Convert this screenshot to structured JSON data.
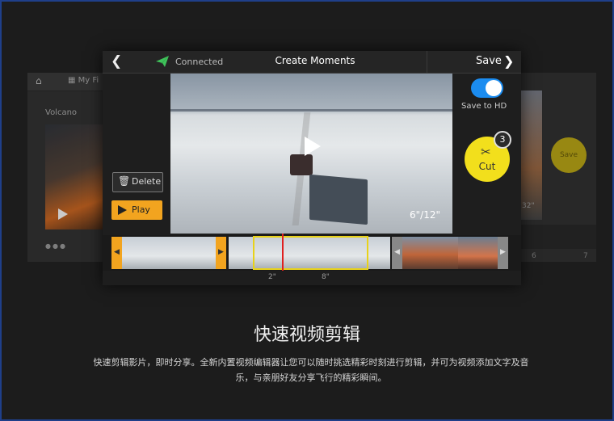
{
  "background_left": {
    "tab_label": "My Fi",
    "album_title": "Volcano"
  },
  "background_right": {
    "save_label": "Save",
    "duration_label": "32\"",
    "numbers": [
      "6",
      "7"
    ]
  },
  "toolbar": {
    "connection_status": "Connected",
    "title": "Create Moments",
    "save_label": "Save"
  },
  "video": {
    "time_display": "6\"/12\""
  },
  "controls": {
    "delete_label": "Delete",
    "play_label": "Play",
    "save_to_hd_label": "Save to HD",
    "save_to_hd_enabled": true,
    "cut_label": "Cut",
    "cut_count": "3"
  },
  "timeline": {
    "markers": [
      "2\"",
      "8\""
    ]
  },
  "caption": {
    "heading": "快速视频剪辑",
    "description": "快速剪辑影片，即时分享。全新内置视频编辑器让您可以随时挑选精彩时刻进行剪辑，并可为视频添加文字及音乐，与亲朋好友分享飞行的精彩瞬间。"
  },
  "colors": {
    "accent_orange": "#f2a41f",
    "cut_yellow": "#f2df1c",
    "toggle_blue": "#1b8cf0",
    "playhead_red": "#e02020"
  }
}
